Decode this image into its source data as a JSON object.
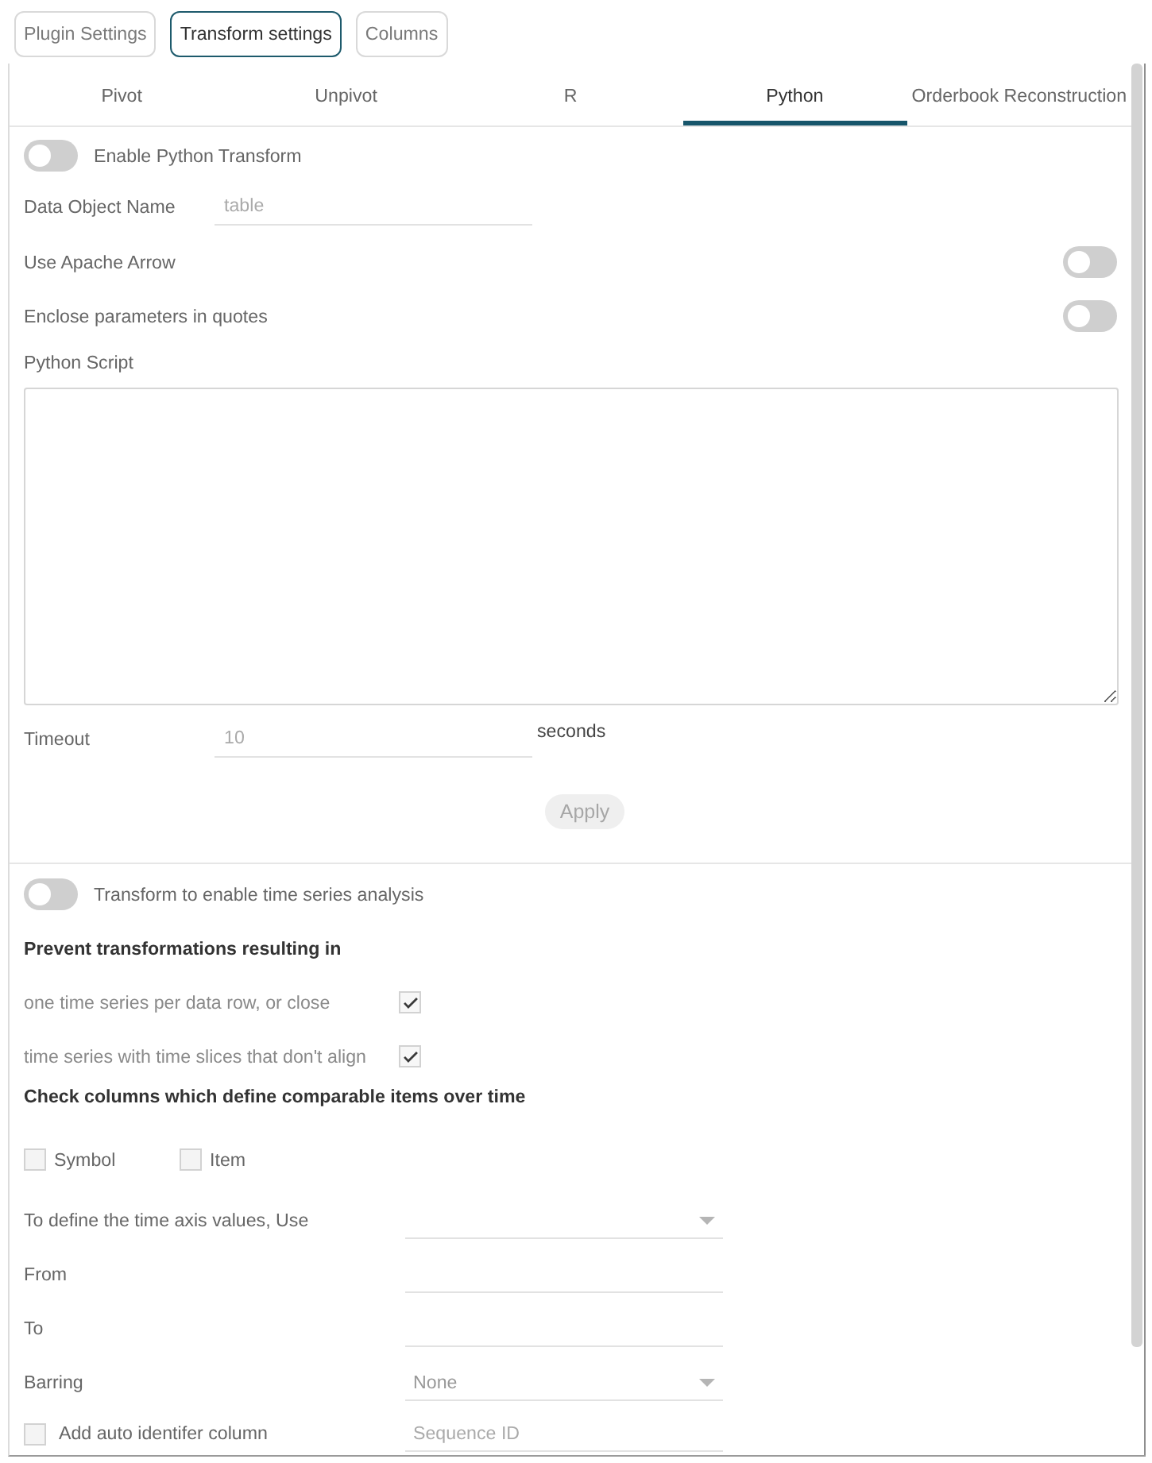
{
  "top_buttons": [
    {
      "label": "Plugin Settings",
      "selected": false
    },
    {
      "label": "Transform settings",
      "selected": true
    },
    {
      "label": "Columns",
      "selected": false
    }
  ],
  "tabs": [
    {
      "label": "Pivot",
      "selected": false
    },
    {
      "label": "Unpivot",
      "selected": false
    },
    {
      "label": "R",
      "selected": false
    },
    {
      "label": "Python",
      "selected": true
    },
    {
      "label": "Orderbook Reconstruction",
      "selected": false
    }
  ],
  "python": {
    "enable_toggle": {
      "label": "Enable Python Transform",
      "on": false
    },
    "data_object_name": {
      "label": "Data Object Name",
      "placeholder": "table"
    },
    "use_apache_arrow": {
      "label": "Use Apache Arrow",
      "on": false
    },
    "enclose_parameters": {
      "label": "Enclose parameters in quotes",
      "on": false
    },
    "script": {
      "label": "Python Script"
    },
    "timeout": {
      "label": "Timeout",
      "placeholder": "10",
      "unit": "seconds"
    },
    "apply_button": {
      "label": "Apply",
      "disabled": true
    }
  },
  "time_series": {
    "toggle": {
      "label": "Transform to enable time series analysis",
      "on": false
    },
    "prevent_heading": "Prevent transformations resulting in",
    "prevent_options": [
      {
        "label": "one time series per data row, or close",
        "checked": true
      },
      {
        "label": "time series with time slices that don't align",
        "checked": true
      }
    ],
    "columns_heading": "Check columns which define comparable items over time",
    "columns": [
      {
        "label": "Symbol",
        "checked": false
      },
      {
        "label": "Item",
        "checked": false
      }
    ],
    "fields": [
      {
        "kind": "dropdown",
        "label": "To define the time axis values, Use"
      },
      {
        "kind": "text",
        "label": "From"
      },
      {
        "kind": "text",
        "label": "To"
      },
      {
        "kind": "dropdown",
        "label": "Barring",
        "value": "None"
      }
    ],
    "auto_identifier": {
      "label": "Add auto identifer column",
      "checked": false,
      "placeholder": "Sequence ID"
    }
  }
}
